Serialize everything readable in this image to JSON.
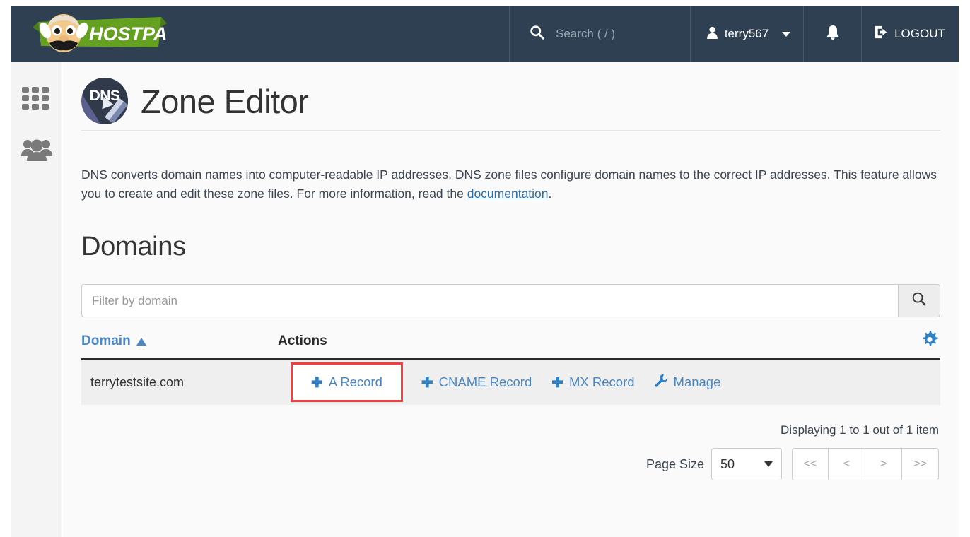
{
  "topbar": {
    "brand_name": "HOSTPAPA",
    "search_placeholder": "Search ( / )",
    "search_icon": "search-icon",
    "user_name": "terry567",
    "user_icon": "user-icon",
    "bell_icon": "bell-icon",
    "logout_label": "LOGOUT",
    "logout_icon": "logout-icon",
    "bg_color": "#2e4052"
  },
  "sidebar": {
    "items": [
      {
        "icon": "grid-apps-icon",
        "name": "apps"
      },
      {
        "icon": "users-group-icon",
        "name": "users"
      }
    ]
  },
  "page": {
    "badge_text": "DNS",
    "badge_icon": "dns-pencil-icon",
    "title": "Zone Editor",
    "intro_part1": "DNS converts domain names into computer-readable IP addresses. DNS zone files configure domain names to the correct IP addresses. This feature allows you to create and edit these zone files. For more information, read the ",
    "intro_link": "documentation",
    "intro_part2": ".",
    "section_title": "Domains"
  },
  "filter": {
    "placeholder": "Filter by domain",
    "value": "",
    "search_icon": "magnifier-icon"
  },
  "table": {
    "columns": {
      "domain": "Domain",
      "sort_indicator": "▲",
      "actions": "Actions"
    },
    "settings_icon": "gear-icon",
    "rows": [
      {
        "domain": "terrytestsite.com",
        "actions": [
          {
            "label": "A Record",
            "icon": "plus-icon",
            "highlighted": true
          },
          {
            "label": "CNAME Record",
            "icon": "plus-icon",
            "highlighted": false
          },
          {
            "label": "MX Record",
            "icon": "plus-icon",
            "highlighted": false
          },
          {
            "label": "Manage",
            "icon": "wrench-icon",
            "highlighted": false
          }
        ]
      }
    ]
  },
  "pagination": {
    "displaying": "Displaying 1 to 1 out of 1 item",
    "page_size_label": "Page Size",
    "page_size_value": "50",
    "buttons": [
      "<<",
      "<",
      ">",
      ">>"
    ]
  },
  "colors": {
    "accent_blue": "#4a87c7",
    "header_bg": "#2e4052",
    "highlight_red": "#fa3c3c",
    "brand_green": "#64a121"
  }
}
